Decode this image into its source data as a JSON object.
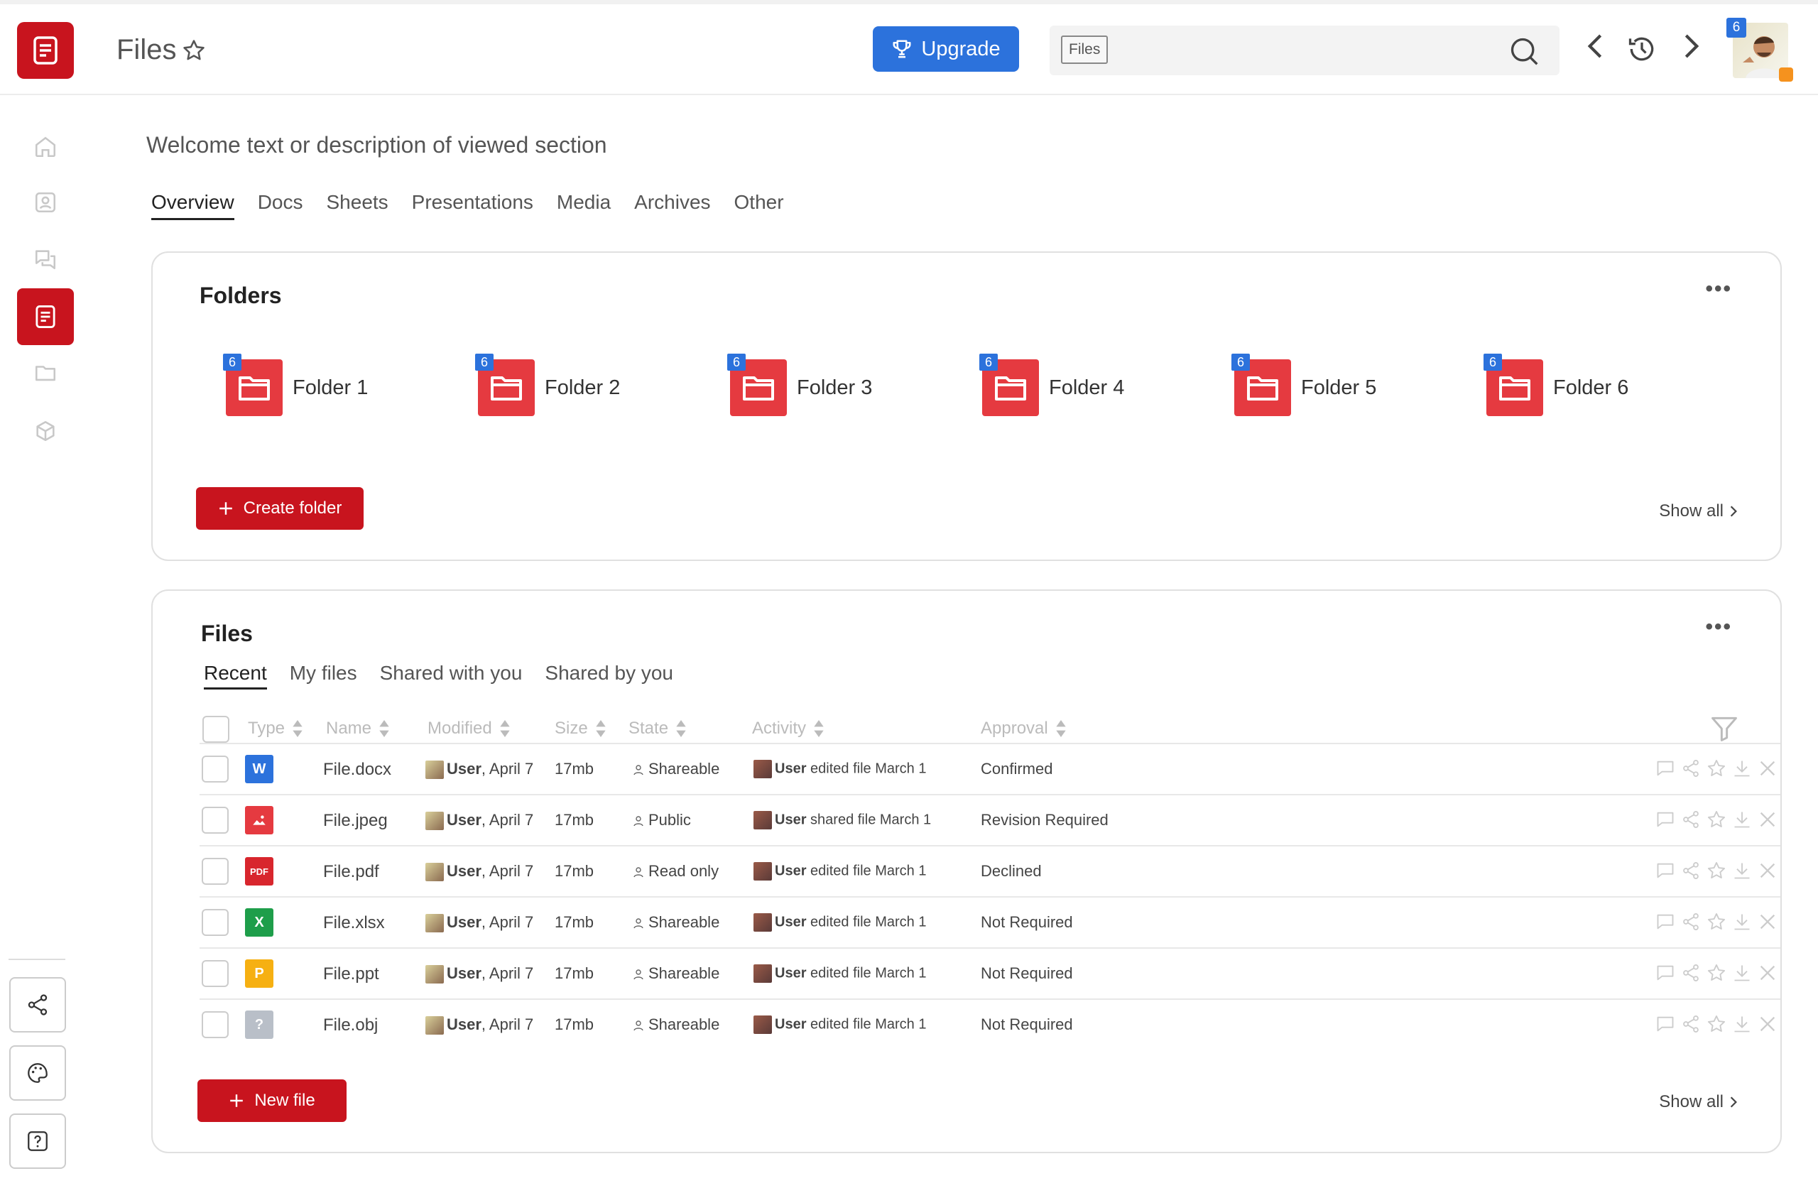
{
  "header": {
    "title": "Files",
    "upgrade_label": "Upgrade",
    "search_scope": "Files",
    "avatar_badge": "6"
  },
  "welcome": "Welcome text or description of viewed section",
  "tabs": [
    "Overview",
    "Docs",
    "Sheets",
    "Presentations",
    "Media",
    "Archives",
    "Other"
  ],
  "folders_card": {
    "title": "Folders",
    "more": "•••",
    "items": [
      {
        "label": "Folder 1",
        "badge": "6"
      },
      {
        "label": "Folder 2",
        "badge": "6"
      },
      {
        "label": "Folder 3",
        "badge": "6"
      },
      {
        "label": "Folder 4",
        "badge": "6"
      },
      {
        "label": "Folder 5",
        "badge": "6"
      },
      {
        "label": "Folder 6",
        "badge": "6"
      }
    ],
    "create_label": "Create folder",
    "show_all": "Show all"
  },
  "files_card": {
    "title": "Files",
    "more": "•••",
    "subtabs": [
      "Recent",
      "My files",
      "Shared with you",
      "Shared by you"
    ],
    "columns": [
      "Type",
      "Name",
      "Modified",
      "Size",
      "State",
      "Activity",
      "Approval"
    ],
    "rows": [
      {
        "type": "W",
        "type_color": "#2c72dc",
        "name": "File.docx",
        "user": "User",
        "date": ", April 7",
        "size": "17mb",
        "state": "Shareable",
        "act_user": "User",
        "act_text": " edited file March 1",
        "approval": "Confirmed"
      },
      {
        "type": "img",
        "type_color": "#e53a40",
        "name": "File.jpeg",
        "user": "User",
        "date": ", April 7",
        "size": "17mb",
        "state": "Public",
        "act_user": "User",
        "act_text": " shared file March 1",
        "approval": "Revision Required"
      },
      {
        "type": "PDF",
        "type_color": "#d8262d",
        "name": "File.pdf",
        "user": "User",
        "date": ", April 7",
        "size": "17mb",
        "state": "Read only",
        "act_user": "User",
        "act_text": " edited file March 1",
        "approval": "Declined"
      },
      {
        "type": "X",
        "type_color": "#1e9e4a",
        "name": "File.xlsx",
        "user": "User",
        "date": ", April 7",
        "size": "17mb",
        "state": "Shareable",
        "act_user": "User",
        "act_text": " edited file March 1",
        "approval": "Not Required"
      },
      {
        "type": "P",
        "type_color": "#f6b012",
        "name": "File.ppt",
        "user": "User",
        "date": ", April 7",
        "size": "17mb",
        "state": "Shareable",
        "act_user": "User",
        "act_text": " edited file March 1",
        "approval": "Not Required"
      },
      {
        "type": "?",
        "type_color": "#b9bfc8",
        "name": "File.obj",
        "user": "User",
        "date": ", April 7",
        "size": "17mb",
        "state": "Shareable",
        "act_user": "User",
        "act_text": " edited file March 1",
        "approval": "Not Required"
      }
    ],
    "new_label": "New file",
    "show_all": "Show all"
  },
  "colors": {
    "brand": "#c8141e",
    "accent": "#2c72dc",
    "folder": "#e53a40"
  }
}
